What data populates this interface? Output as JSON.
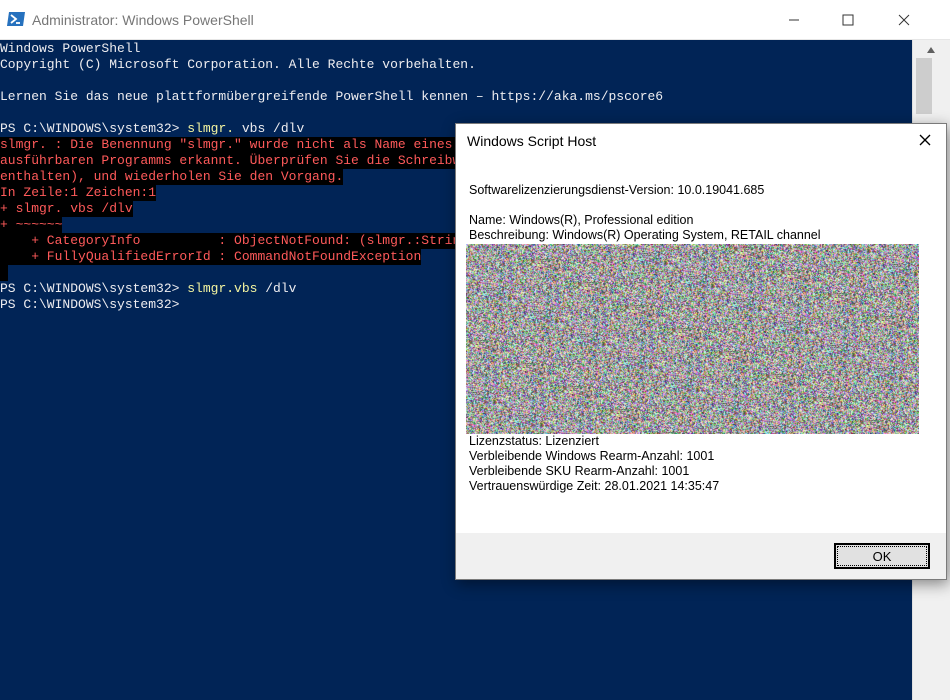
{
  "powershell": {
    "title": "Administrator: Windows PowerShell",
    "lines": [
      {
        "type": "out",
        "text": "Windows PowerShell"
      },
      {
        "type": "out",
        "text": "Copyright (C) Microsoft Corporation. Alle Rechte vorbehalten."
      },
      {
        "type": "out",
        "text": ""
      },
      {
        "type": "out",
        "text": "Lernen Sie das neue plattformübergreifende PowerShell kennen – https://aka.ms/pscore6"
      },
      {
        "type": "out",
        "text": ""
      },
      {
        "type": "cmd",
        "prompt": "PS C:\\WINDOWS\\system32> ",
        "exe": "slmgr.",
        "args": " vbs /dlv"
      },
      {
        "type": "err",
        "text": "slmgr. : Die Benennung \"slmgr.\" wurde nicht als Name eines C"
      },
      {
        "type": "err",
        "text": "ausführbaren Programms erkannt. Überprüfen Sie die Schreibwe"
      },
      {
        "type": "err",
        "text": "enthalten), und wiederholen Sie den Vorgang."
      },
      {
        "type": "err",
        "text": "In Zeile:1 Zeichen:1"
      },
      {
        "type": "err",
        "text": "+ slmgr. vbs /dlv"
      },
      {
        "type": "err",
        "text": "+ ~~~~~~"
      },
      {
        "type": "err",
        "text": "    + CategoryInfo          : ObjectNotFound: (slmgr.:String"
      },
      {
        "type": "err",
        "text": "    + FullyQualifiedErrorId : CommandNotFoundException"
      },
      {
        "type": "err",
        "text": " "
      },
      {
        "type": "cmd",
        "prompt": "PS C:\\WINDOWS\\system32> ",
        "exe": "slmgr.vbs",
        "args": " /dlv"
      },
      {
        "type": "out",
        "text": "PS C:\\WINDOWS\\system32>"
      }
    ]
  },
  "dialog": {
    "title": "Windows Script Host",
    "version_line": "Softwarelizenzierungsdienst-Version: 10.0.19041.685",
    "name_line": "Name: Windows(R), Professional edition",
    "description_line": "Beschreibung: Windows(R) Operating System, RETAIL channel",
    "status_line": "Lizenzstatus: Lizenziert",
    "windows_rearm_line": "Verbleibende Windows Rearm-Anzahl: 1001",
    "sku_rearm_line": "Verbleibende SKU Rearm-Anzahl: 1001",
    "trusted_time_line": "Vertrauenswürdige Zeit: 28.01.2021 14:35:47",
    "ok_label": "OK"
  },
  "colors": {
    "console_bg": "#012456",
    "console_text": "#eeedf0",
    "error_text": "#ff5a5a",
    "error_bg": "#000000",
    "command_text": "#f5f5a0"
  },
  "icons": {
    "app": "powershell-icon",
    "minimize": "minimize-icon",
    "maximize": "maximize-icon",
    "close": "close-icon",
    "scroll_up": "scroll-up-icon"
  }
}
